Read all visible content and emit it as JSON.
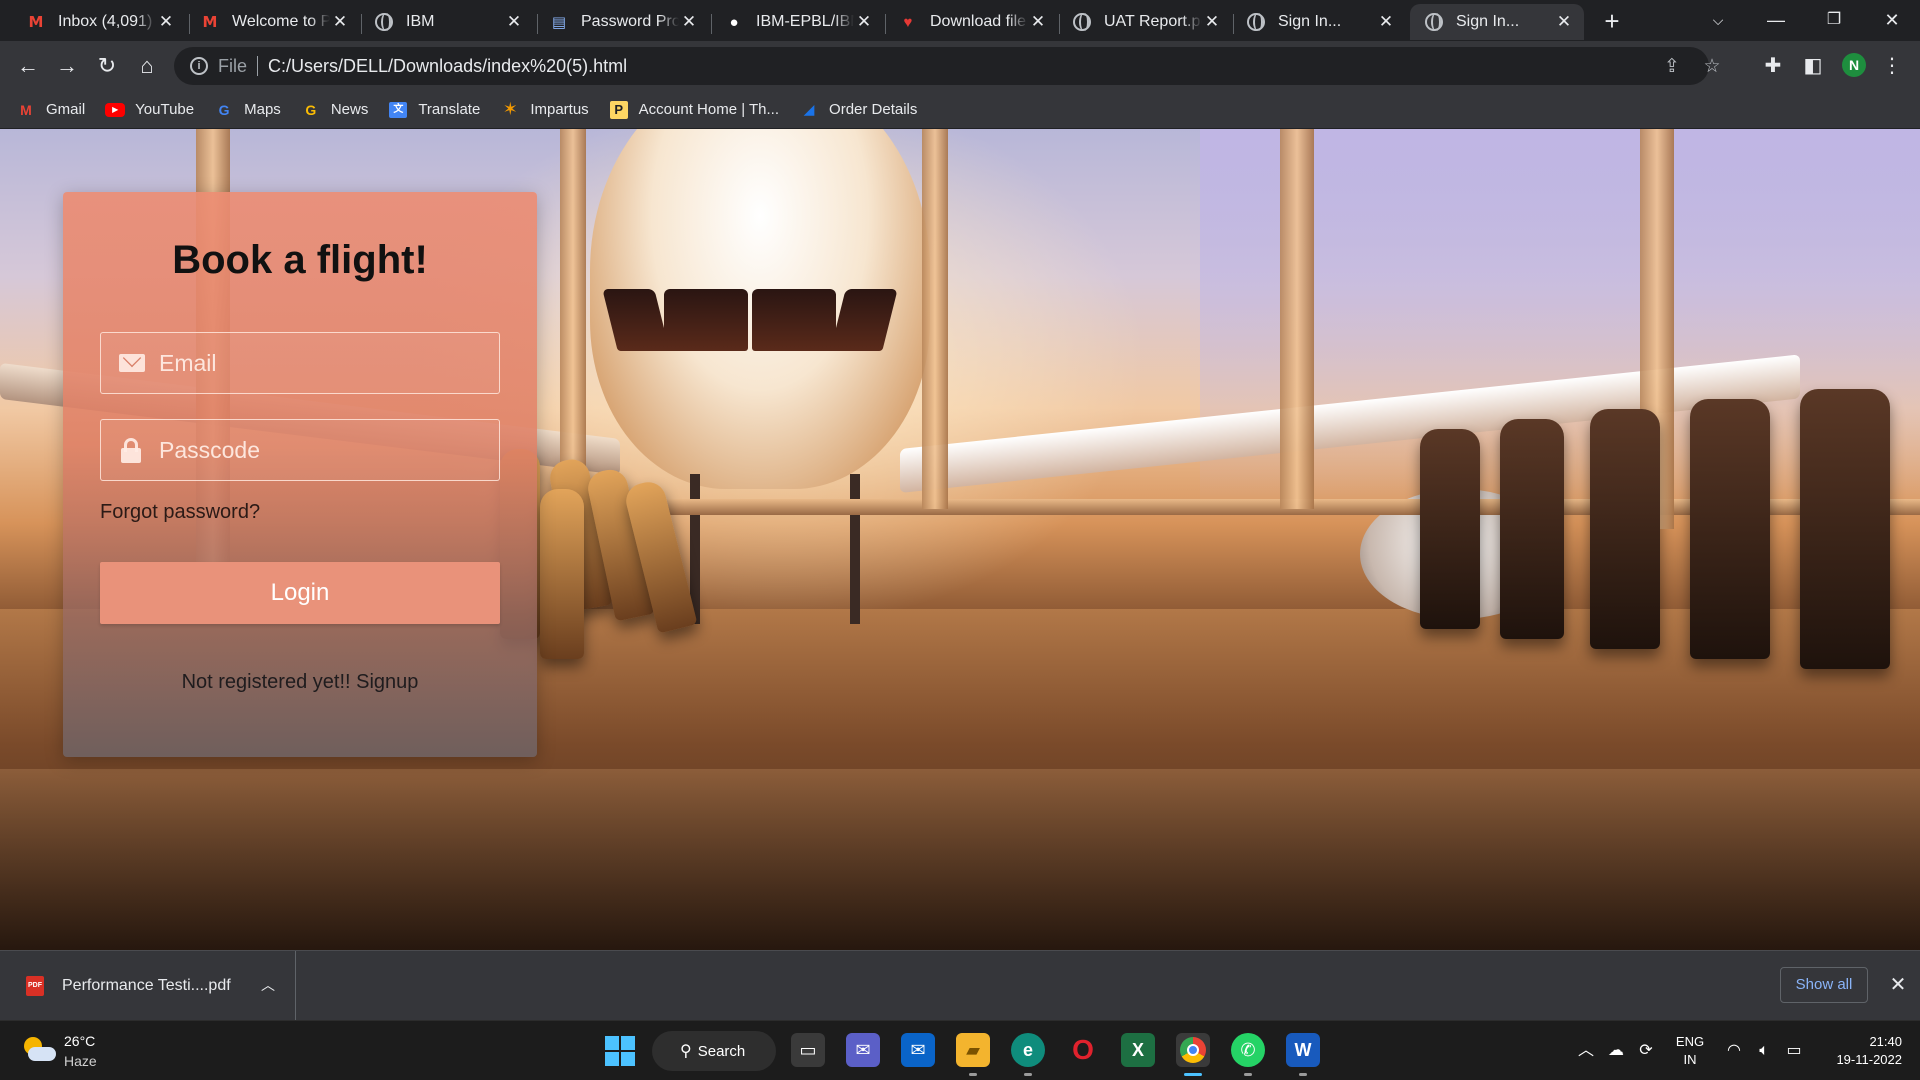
{
  "tabs": [
    {
      "icon": "gmail-icon",
      "title": "Inbox (4,091) - ",
      "active": false
    },
    {
      "icon": "gmail-icon",
      "title": "Welcome to P",
      "active": false
    },
    {
      "icon": "globe-icon",
      "title": "IBM",
      "active": false
    },
    {
      "icon": "document-icon",
      "title": "Password Prot",
      "active": false
    },
    {
      "icon": "github-icon",
      "title": "IBM-EPBL/IBM",
      "active": false
    },
    {
      "icon": "heart-icon",
      "title": "Download file",
      "active": false
    },
    {
      "icon": "globe-icon",
      "title": "UAT Report.pc",
      "active": false
    },
    {
      "icon": "globe-icon",
      "title": "Sign In...",
      "active": false
    },
    {
      "icon": "globe-icon",
      "title": "Sign In...",
      "active": true
    }
  ],
  "toolbar": {
    "scheme_label": "File",
    "url": "C:/Users/DELL/Downloads/index%20(5).html",
    "profile_initial": "N"
  },
  "bookmarks": [
    {
      "label": "Gmail",
      "icon": "gmail-icon",
      "color": "#ea4335"
    },
    {
      "label": "YouTube",
      "icon": "youtube-icon",
      "color": "#ff0000"
    },
    {
      "label": "Maps",
      "icon": "google-icon",
      "color": "#4285f4"
    },
    {
      "label": "News",
      "icon": "google-news-icon",
      "color": "#fbbc04"
    },
    {
      "label": "Translate",
      "icon": "translate-icon",
      "color": "#4285f4"
    },
    {
      "label": "Impartus",
      "icon": "impartus-icon",
      "color": "#f29900"
    },
    {
      "label": "Account Home | Th...",
      "icon": "account-icon",
      "color": "#fdd663"
    },
    {
      "label": "Order Details",
      "icon": "order-icon",
      "color": "#1a73e8"
    }
  ],
  "login": {
    "title": "Book a flight!",
    "email_placeholder": "Email",
    "passcode_placeholder": "Passcode",
    "forgot_label": "Forgot password?",
    "login_label": "Login",
    "signup_label": "Not registered yet!! Signup"
  },
  "download_shelf": {
    "file_name": "Performance Testi....pdf",
    "file_icon_text": "PDF",
    "show_all_label": "Show all"
  },
  "taskbar": {
    "temperature": "26°C",
    "condition": "Haze",
    "search_label": "Search",
    "language_top": "ENG",
    "language_bottom": "IN",
    "time": "21:40",
    "date": "19-11-2022"
  },
  "colors": {
    "accent_button": "#e9927a",
    "card_top": "#ec8c72",
    "chrome_dark": "#202124",
    "chrome_toolbar": "#35363a",
    "link_blue": "#8ab4f8",
    "windows_blue": "#4cc2ff"
  }
}
